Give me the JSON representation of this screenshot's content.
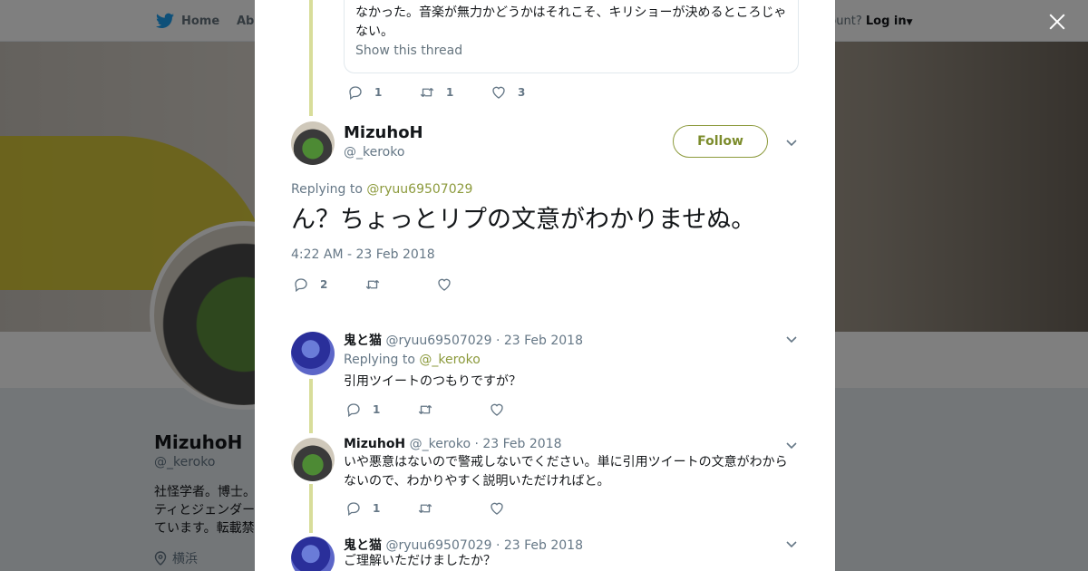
{
  "background": {
    "nav": {
      "home_label": "Home",
      "about_label": "Abo",
      "account_text": "ccount?",
      "login_label": "Log in"
    },
    "profile": {
      "name": "MizuhoH",
      "handle": "@_keroko",
      "bio_lines": [
        "社怪学者。博士。",
        "ティとジェンダー",
        "ています。転載禁"
      ],
      "location": "横浜"
    }
  },
  "modal": {
    "quoted": {
      "text_lines": [
        "なかった。音楽が無力かどうかはそれこそ、キリショーが決めるところじゃ",
        "ない。"
      ],
      "show_thread_label": "Show this thread",
      "replies": "1",
      "retweets": "1",
      "likes": "3"
    },
    "main_tweet": {
      "name": "MizuhoH",
      "handle": "@_keroko",
      "follow_label": "Follow",
      "replying_prefix": "Replying to",
      "replying_to": "@ryuu69507029",
      "text": "ん？ちょっとリプの文意がわかりませぬ。",
      "timestamp": "4:22 AM - 23 Feb 2018",
      "replies": "2"
    },
    "replies": [
      {
        "name": "鬼と猫",
        "handle": "@ryuu69507029",
        "date": "· 23 Feb 2018",
        "replying_prefix": "Replying to",
        "replying_to": "@_keroko",
        "text": "引用ツイートのつもりですが？",
        "replies": "1"
      },
      {
        "name": "MizuhoH",
        "handle": "@_keroko",
        "date": "· 23 Feb 2018",
        "text_lines": [
          "いや悪意はないので警戒しないでください。単に引用ツイートの文意がわから",
          "ないので、わかりやすく説明いただければと。"
        ],
        "replies": "1"
      },
      {
        "name": "鬼と猫",
        "handle": "@ryuu69507029",
        "date": "· 23 Feb 2018",
        "text": "ご理解いただけましたか？"
      }
    ]
  },
  "colors": {
    "accent": "#8c9a3c",
    "thread_line": "#d8dd9a",
    "muted": "#657786"
  }
}
